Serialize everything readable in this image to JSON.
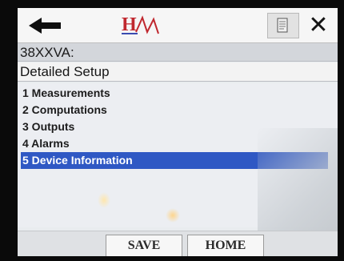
{
  "topbar": {
    "back_icon": "back-arrow-icon",
    "logo_text": "H",
    "doc_icon": "document-icon",
    "close_icon": "close-icon",
    "close_symbol": "✕"
  },
  "device": {
    "title": "38XXVA:"
  },
  "menu": {
    "title": "Detailed Setup",
    "items": [
      {
        "label": "1 Measurements"
      },
      {
        "label": "2 Computations"
      },
      {
        "label": "3 Outputs"
      },
      {
        "label": "4 Alarms"
      },
      {
        "label": "5 Device Information"
      }
    ],
    "selected_index": 4
  },
  "buttons": {
    "save_label": "SAVE",
    "home_label": "HOME"
  },
  "colors": {
    "accent": "#2f58c4",
    "logo_red": "#c0282f"
  }
}
